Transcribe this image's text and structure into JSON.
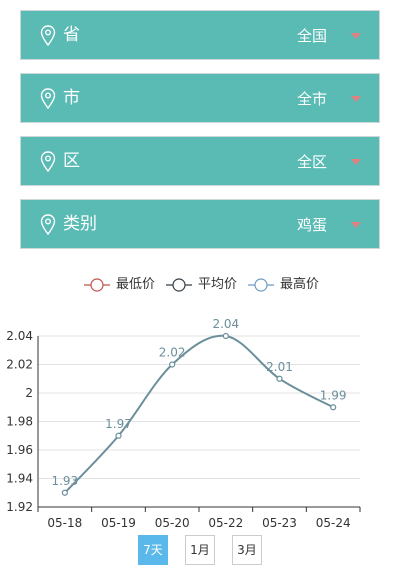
{
  "filters": [
    {
      "label": "省",
      "value": "全国",
      "icon": "location-pin-icon"
    },
    {
      "label": "市",
      "value": "全市",
      "icon": "location-pin-icon"
    },
    {
      "label": "区",
      "value": "全区",
      "icon": "location-pin-icon"
    },
    {
      "label": "类别",
      "value": "鸡蛋",
      "icon": "location-pin-icon"
    }
  ],
  "legend": [
    {
      "label": "最低价",
      "color": "#c0504d"
    },
    {
      "label": "平均价",
      "color": "#333d47"
    },
    {
      "label": "最高价",
      "color": "#6d9bc3"
    }
  ],
  "chart_data": {
    "type": "line",
    "categories": [
      "05-18",
      "05-19",
      "05-20",
      "05-22",
      "05-23",
      "05-24"
    ],
    "values": [
      1.93,
      1.97,
      2.02,
      2.04,
      2.01,
      1.99
    ],
    "data_labels": [
      "1.93",
      "1.97",
      "2.02",
      "2.04",
      "2.01",
      "1.99"
    ],
    "ylim": [
      1.92,
      2.04
    ],
    "yticks": [
      "1.92",
      "1.94",
      "1.96",
      "1.98",
      "2",
      "2.02",
      "2.04"
    ],
    "line_color": "#6b8f9b",
    "grid": true,
    "legend_position": "top"
  },
  "ranges": [
    {
      "label": "7天",
      "active": true
    },
    {
      "label": "1月",
      "active": false
    },
    {
      "label": "3月",
      "active": false
    }
  ]
}
